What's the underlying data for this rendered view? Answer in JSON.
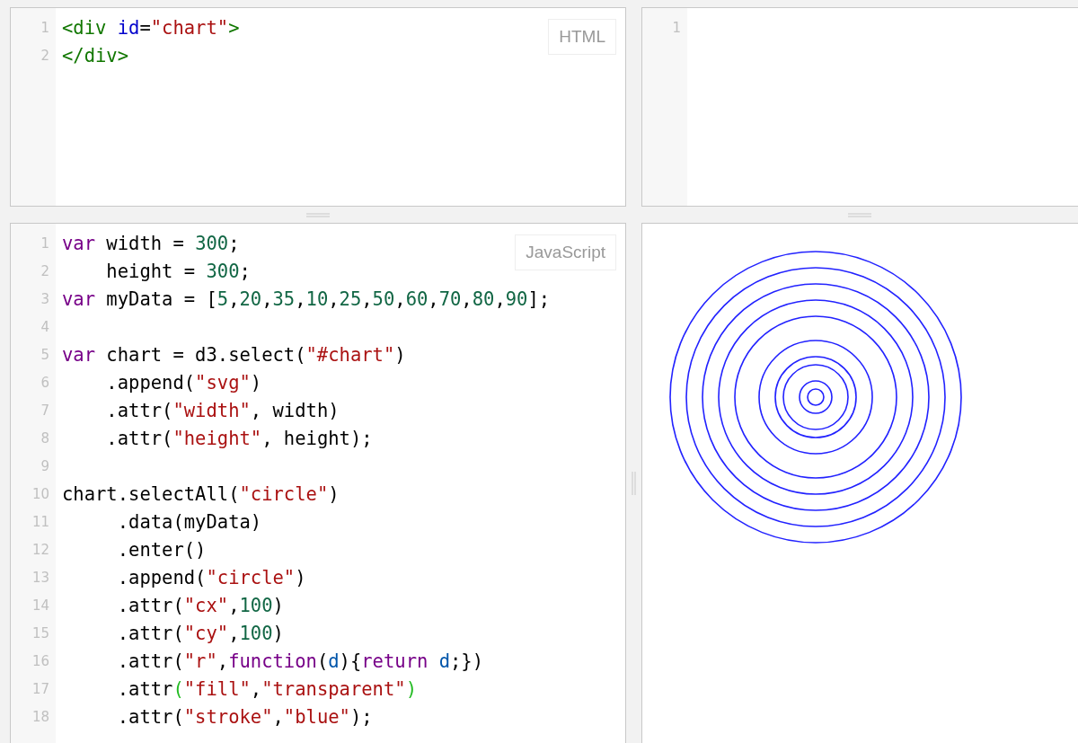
{
  "panels": [
    {
      "kind": "code",
      "language": "HTML",
      "lines": [
        {
          "number": "1",
          "tokens": [
            {
              "kind": "tag",
              "text": "<div"
            },
            {
              "kind": "attribute",
              "text": " id"
            },
            {
              "kind": "plain",
              "text": "="
            },
            {
              "kind": "string",
              "text": "\"chart\""
            },
            {
              "kind": "tag",
              "text": ">"
            }
          ]
        },
        {
          "number": "2",
          "tokens": [
            {
              "kind": "tag",
              "text": "</div>"
            }
          ]
        }
      ]
    },
    {
      "kind": "code",
      "lines": [
        {
          "number": "1"
        }
      ]
    },
    {
      "kind": "code",
      "language": "JavaScript",
      "lines": [
        {
          "number": "1",
          "tokens": [
            {
              "kind": "keyword",
              "text": "var"
            },
            {
              "kind": "plain",
              "text": " width = "
            },
            {
              "kind": "number",
              "text": "300"
            },
            {
              "kind": "plain",
              "text": ";"
            }
          ]
        },
        {
          "number": "2",
          "tokens": [
            {
              "kind": "plain",
              "text": "    height = "
            },
            {
              "kind": "number",
              "text": "300"
            },
            {
              "kind": "plain",
              "text": ";"
            }
          ]
        },
        {
          "number": "3",
          "tokens": [
            {
              "kind": "keyword",
              "text": "var"
            },
            {
              "kind": "plain",
              "text": " myData = ["
            },
            {
              "kind": "number",
              "text": "5"
            },
            {
              "kind": "plain",
              "text": ","
            },
            {
              "kind": "number",
              "text": "20"
            },
            {
              "kind": "plain",
              "text": ","
            },
            {
              "kind": "number",
              "text": "35"
            },
            {
              "kind": "plain",
              "text": ","
            },
            {
              "kind": "number",
              "text": "10"
            },
            {
              "kind": "plain",
              "text": ","
            },
            {
              "kind": "number",
              "text": "25"
            },
            {
              "kind": "plain",
              "text": ","
            },
            {
              "kind": "number",
              "text": "50"
            },
            {
              "kind": "plain",
              "text": ","
            },
            {
              "kind": "number",
              "text": "60"
            },
            {
              "kind": "plain",
              "text": ","
            },
            {
              "kind": "number",
              "text": "70"
            },
            {
              "kind": "plain",
              "text": ","
            },
            {
              "kind": "number",
              "text": "80"
            },
            {
              "kind": "plain",
              "text": ","
            },
            {
              "kind": "number",
              "text": "90"
            },
            {
              "kind": "plain",
              "text": "];"
            }
          ]
        },
        {
          "number": "4"
        },
        {
          "number": "5",
          "tokens": [
            {
              "kind": "keyword",
              "text": "var"
            },
            {
              "kind": "plain",
              "text": " chart = d3.select("
            },
            {
              "kind": "string",
              "text": "\"#chart\""
            },
            {
              "kind": "plain",
              "text": ")"
            }
          ]
        },
        {
          "number": "6",
          "tokens": [
            {
              "kind": "plain",
              "text": "    .append("
            },
            {
              "kind": "string",
              "text": "\"svg\""
            },
            {
              "kind": "plain",
              "text": ")"
            }
          ]
        },
        {
          "number": "7",
          "tokens": [
            {
              "kind": "plain",
              "text": "    .attr("
            },
            {
              "kind": "string",
              "text": "\"width\""
            },
            {
              "kind": "plain",
              "text": ", width)"
            }
          ]
        },
        {
          "number": "8",
          "tokens": [
            {
              "kind": "plain",
              "text": "    .attr("
            },
            {
              "kind": "string",
              "text": "\"height\""
            },
            {
              "kind": "plain",
              "text": ", height);"
            }
          ]
        },
        {
          "number": "9"
        },
        {
          "number": "10",
          "tokens": [
            {
              "kind": "plain",
              "text": "chart.selectAll("
            },
            {
              "kind": "string",
              "text": "\"circle\""
            },
            {
              "kind": "plain",
              "text": ")"
            }
          ]
        },
        {
          "number": "11",
          "tokens": [
            {
              "kind": "plain",
              "text": "     .data(myData)"
            }
          ]
        },
        {
          "number": "12",
          "tokens": [
            {
              "kind": "plain",
              "text": "     .enter()"
            }
          ]
        },
        {
          "number": "13",
          "tokens": [
            {
              "kind": "plain",
              "text": "     .append("
            },
            {
              "kind": "string",
              "text": "\"circle\""
            },
            {
              "kind": "plain",
              "text": ")"
            }
          ]
        },
        {
          "number": "14",
          "tokens": [
            {
              "kind": "plain",
              "text": "     .attr("
            },
            {
              "kind": "string",
              "text": "\"cx\""
            },
            {
              "kind": "plain",
              "text": ","
            },
            {
              "kind": "number",
              "text": "100"
            },
            {
              "kind": "plain",
              "text": ")"
            }
          ]
        },
        {
          "number": "15",
          "tokens": [
            {
              "kind": "plain",
              "text": "     .attr("
            },
            {
              "kind": "string",
              "text": "\"cy\""
            },
            {
              "kind": "plain",
              "text": ","
            },
            {
              "kind": "number",
              "text": "100"
            },
            {
              "kind": "plain",
              "text": ")"
            }
          ]
        },
        {
          "number": "16",
          "tokens": [
            {
              "kind": "plain",
              "text": "     .attr("
            },
            {
              "kind": "string",
              "text": "\"r\""
            },
            {
              "kind": "plain",
              "text": ","
            },
            {
              "kind": "keyword",
              "text": "function"
            },
            {
              "kind": "plain",
              "text": "("
            },
            {
              "kind": "variable",
              "text": "d"
            },
            {
              "kind": "plain",
              "text": "){"
            },
            {
              "kind": "keyword",
              "text": "return"
            },
            {
              "kind": "variable",
              "text": " d"
            },
            {
              "kind": "plain",
              "text": ";})"
            }
          ]
        },
        {
          "number": "17",
          "tokens": [
            {
              "kind": "plain",
              "text": "     .attr"
            },
            {
              "kind": "matched-bracket",
              "text": "("
            },
            {
              "kind": "string",
              "text": "\"fill\""
            },
            {
              "kind": "plain",
              "text": ","
            },
            {
              "kind": "string",
              "text": "\"transparent\""
            },
            {
              "kind": "matched-bracket",
              "text": ")"
            }
          ]
        },
        {
          "number": "18",
          "tokens": [
            {
              "kind": "plain",
              "text": "     .attr("
            },
            {
              "kind": "string",
              "text": "\"stroke\""
            },
            {
              "kind": "plain",
              "text": ","
            },
            {
              "kind": "string",
              "text": "\"blue\""
            },
            {
              "kind": "plain",
              "text": ");"
            }
          ]
        }
      ]
    },
    {
      "kind": "output"
    }
  ]
}
